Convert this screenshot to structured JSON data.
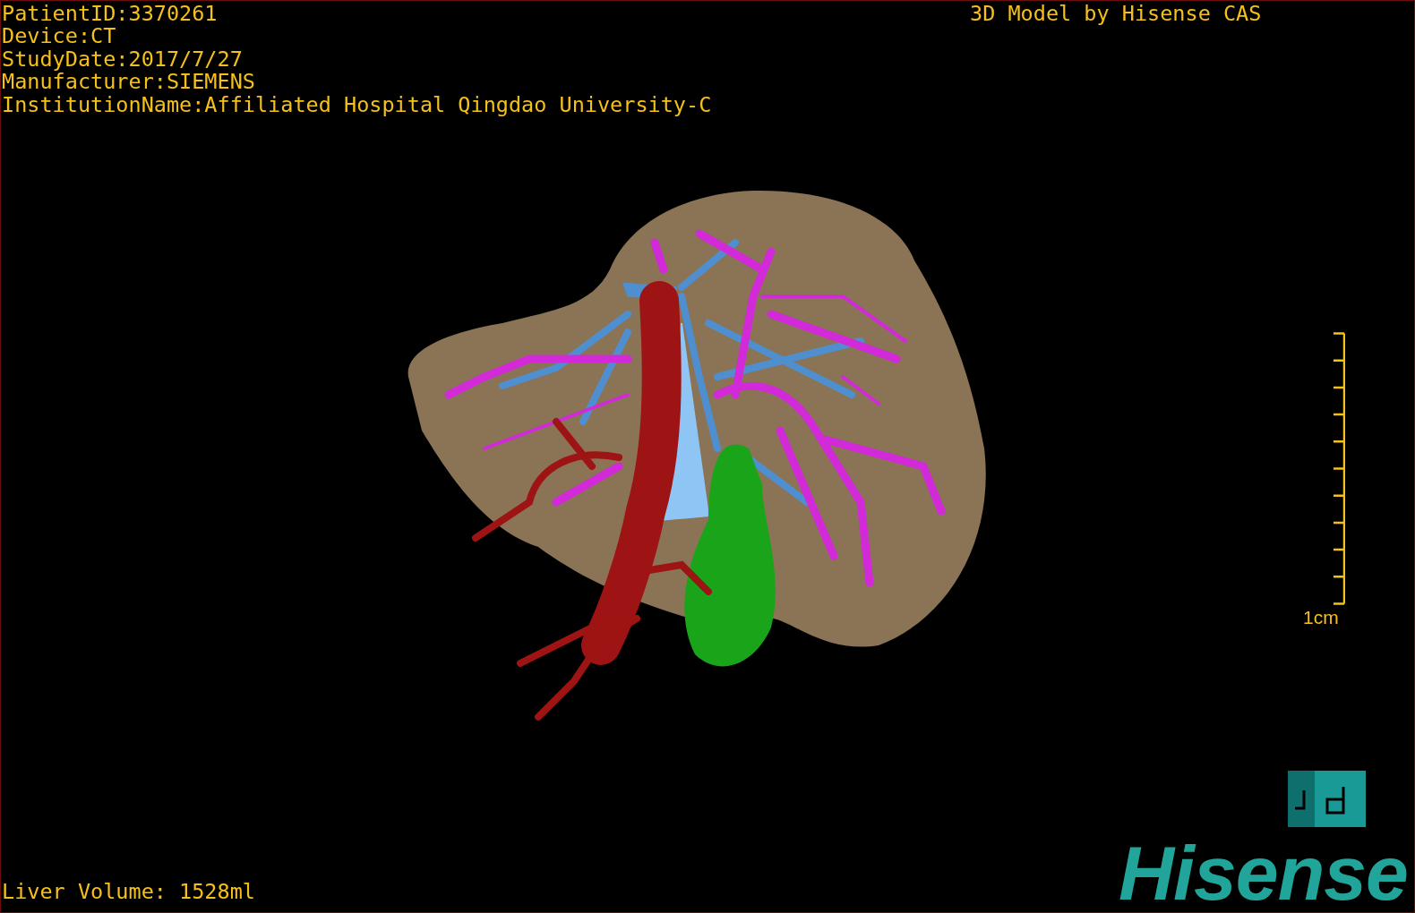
{
  "patient_info": [
    "PatientID:3370261",
    "Device:CT",
    "StudyDate:2017/7/27",
    "Manufacturer:SIEMENS",
    "InstitutionName:Affiliated Hospital Qingdao University-C"
  ],
  "model_credit": "3D Model by Hisense CAS",
  "scale_bar": {
    "label": "1cm"
  },
  "liver_volume": "Liver Volume: 1528ml",
  "logo": "Hisense"
}
